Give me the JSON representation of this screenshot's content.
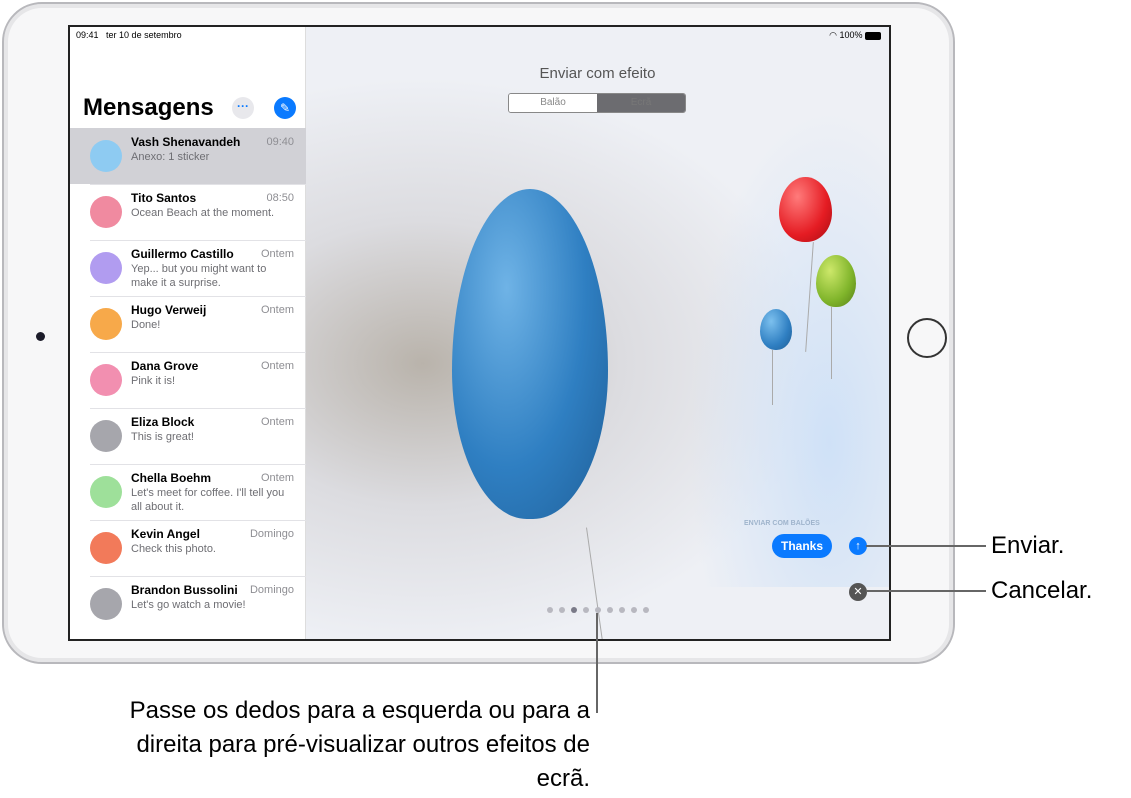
{
  "status": {
    "time": "09:41",
    "date": "ter 10 de setembro",
    "battery": "100%",
    "wifi_icon": "wifi-icon"
  },
  "sidebar": {
    "title": "Mensagens",
    "more_label": "···",
    "compose_icon": "compose-icon",
    "conversations": [
      {
        "name": "Vash Shenavandeh",
        "time": "09:40",
        "preview": "Anexo: 1 sticker",
        "color": "#8ecbf2",
        "selected": true
      },
      {
        "name": "Tito Santos",
        "time": "08:50",
        "preview": "Ocean Beach at the moment.",
        "color": "#f08aa0"
      },
      {
        "name": "Guillermo Castillo",
        "time": "Ontem",
        "preview": "Yep... but you might want to make it a surprise.",
        "color": "#b19cf0"
      },
      {
        "name": "Hugo Verweij",
        "time": "Ontem",
        "preview": "Done!",
        "color": "#f7a94a"
      },
      {
        "name": "Dana Grove",
        "time": "Ontem",
        "preview": "Pink it is!",
        "color": "#f28fb0"
      },
      {
        "name": "Eliza Block",
        "time": "Ontem",
        "preview": "This is great!",
        "color": "#a6a6ac"
      },
      {
        "name": "Chella Boehm",
        "time": "Ontem",
        "preview": "Let's meet for coffee. I'll tell you all about it.",
        "color": "#9ee09a"
      },
      {
        "name": "Kevin Angel",
        "time": "Domingo",
        "preview": "Check this photo.",
        "color": "#f27a5a"
      },
      {
        "name": "Brandon Bussolini",
        "time": "Domingo",
        "preview": "Let's go watch a movie!",
        "color": "#a6a6ac"
      }
    ]
  },
  "effect": {
    "title": "Enviar com efeito",
    "segments": [
      "Balão",
      "Ecrã"
    ],
    "active_segment": "Ecrã",
    "label": "ENVIAR COM BALÕES",
    "message": "Thanks",
    "page_count": 9,
    "active_page": 3
  },
  "callouts": {
    "send": "Enviar.",
    "cancel": "Cancelar.",
    "swipe": "Passe os dedos para a esquerda ou para a direita para pré-visualizar outros efeitos de ecrã."
  },
  "colors": {
    "accent": "#0a7aff"
  }
}
